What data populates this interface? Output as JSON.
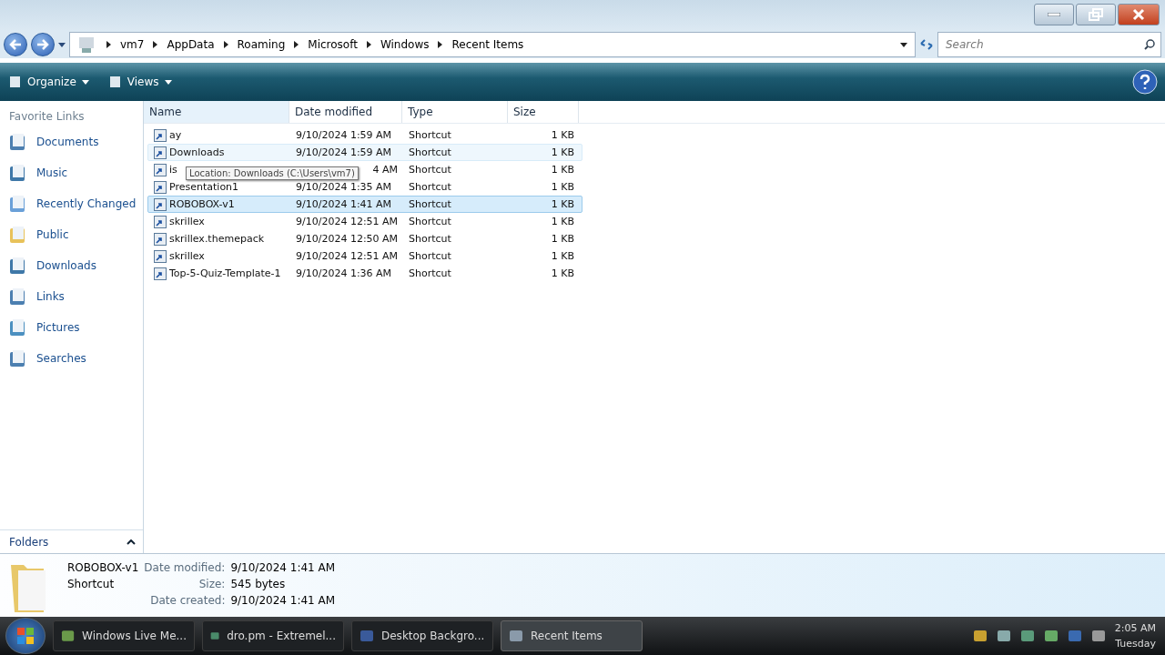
{
  "breadcrumb": [
    "vm7",
    "AppData",
    "Roaming",
    "Microsoft",
    "Windows",
    "Recent Items"
  ],
  "search": {
    "placeholder": "Search"
  },
  "toolbar": [
    "Organize",
    "Views"
  ],
  "sidebar": {
    "title": "Favorite Links",
    "items": [
      {
        "label": "Documents"
      },
      {
        "label": "Music"
      },
      {
        "label": "Recently Changed"
      },
      {
        "label": "Public"
      },
      {
        "label": "Downloads"
      },
      {
        "label": "Links"
      },
      {
        "label": "Pictures"
      },
      {
        "label": "Searches"
      }
    ],
    "folders": "Folders"
  },
  "table": {
    "columns": [
      "Name",
      "Date modified",
      "Type",
      "Size"
    ],
    "rows": [
      {
        "name": "ay",
        "date": "9/10/2024 1:59 AM",
        "type": "Shortcut",
        "size": "1 KB",
        "selected": false,
        "hovered": false,
        "covered": false
      },
      {
        "name": "Downloads",
        "date": "9/10/2024 1:59 AM",
        "type": "Shortcut",
        "size": "1 KB",
        "selected": false,
        "hovered": true,
        "covered": false
      },
      {
        "name": "is",
        "date": "4 AM",
        "type": "Shortcut",
        "size": "1 KB",
        "selected": false,
        "hovered": false,
        "covered": true
      },
      {
        "name": "Presentation1",
        "date": "9/10/2024 1:35 AM",
        "type": "Shortcut",
        "size": "1 KB",
        "selected": false,
        "hovered": false,
        "covered": false
      },
      {
        "name": "ROBOBOX-v1",
        "date": "9/10/2024 1:41 AM",
        "type": "Shortcut",
        "size": "1 KB",
        "selected": true,
        "hovered": false,
        "covered": false
      },
      {
        "name": "skrillex",
        "date": "9/10/2024 12:51 AM",
        "type": "Shortcut",
        "size": "1 KB",
        "selected": false,
        "hovered": false,
        "covered": false
      },
      {
        "name": "skrillex.themepack",
        "date": "9/10/2024 12:50 AM",
        "type": "Shortcut",
        "size": "1 KB",
        "selected": false,
        "hovered": false,
        "covered": false
      },
      {
        "name": "skrillex",
        "date": "9/10/2024 12:51 AM",
        "type": "Shortcut",
        "size": "1 KB",
        "selected": false,
        "hovered": false,
        "covered": false
      },
      {
        "name": "Top-5-Quiz-Template-1",
        "date": "9/10/2024 1:36 AM",
        "type": "Shortcut",
        "size": "1 KB",
        "selected": false,
        "hovered": false,
        "covered": false
      }
    ]
  },
  "tooltip": "Location: Downloads (C:\\Users\\vm7)",
  "details": {
    "name": "ROBOBOX-v1",
    "type": "Shortcut",
    "fields": [
      {
        "label": "Date modified:",
        "value": "9/10/2024 1:41 AM"
      },
      {
        "label": "Size:",
        "value": "545 bytes"
      },
      {
        "label": "Date created:",
        "value": "9/10/2024 1:41 AM"
      }
    ]
  },
  "taskbar": {
    "buttons": [
      {
        "label": "Windows Live Me...",
        "selected": false
      },
      {
        "label": "dro.pm - Extremel...",
        "selected": false
      },
      {
        "label": "Desktop Backgro...",
        "selected": false
      },
      {
        "label": "Recent Items",
        "selected": true
      }
    ],
    "time": "2:05 AM",
    "day": "Tuesday"
  }
}
